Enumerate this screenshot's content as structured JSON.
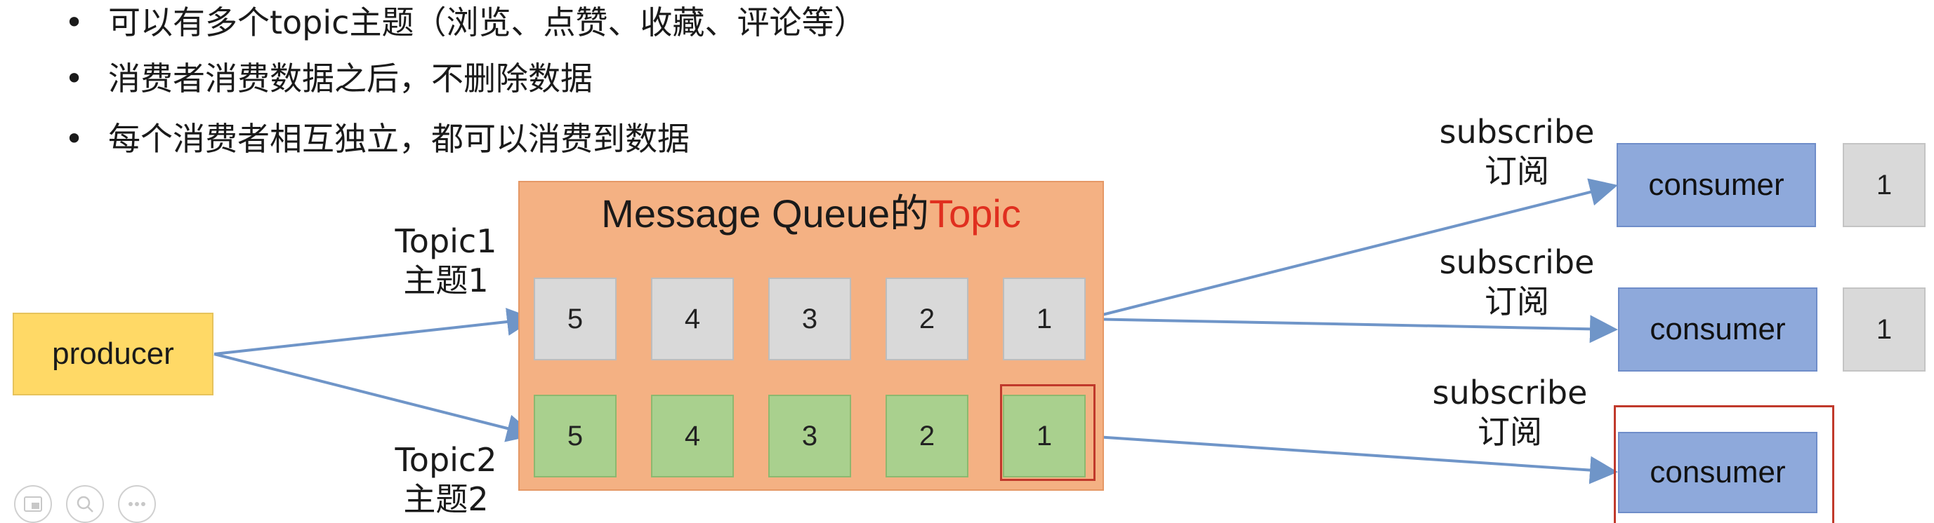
{
  "bullets": [
    "可以有多个topic主题（浏览、点赞、收藏、评论等）",
    "消费者消费数据之后，不删除数据",
    "每个消费者相互独立，都可以消费到数据"
  ],
  "bullet_symbol": "•",
  "queue": {
    "title_prefix": "Message Queue的",
    "title_highlight": "Topic",
    "highlight_color": "#e02f1f",
    "background": "#f4b183",
    "topic1_cells": [
      "5",
      "4",
      "3",
      "2",
      "1"
    ],
    "topic2_cells": [
      "5",
      "4",
      "3",
      "2",
      "1"
    ]
  },
  "producer": {
    "label": "producer",
    "color": "#ffd966"
  },
  "topic1_label": {
    "line1": "Topic1",
    "line2": "主题1"
  },
  "topic2_label": {
    "line1": "Topic2",
    "line2": "主题2"
  },
  "subscribe_labels": [
    {
      "line1": "subscribe",
      "line2": "订阅"
    },
    {
      "line1": "subscribe",
      "line2": "订阅"
    },
    {
      "line1": "subscribe",
      "line2": "订阅"
    }
  ],
  "consumers": [
    "consumer",
    "consumer",
    "consumer"
  ],
  "consumer_side_values": [
    "1",
    "1"
  ],
  "arrow_color": "#6f95c8",
  "highlight_box_color": "#c0392b",
  "controls": [
    "pip-icon",
    "zoom-icon",
    "more-icon"
  ]
}
